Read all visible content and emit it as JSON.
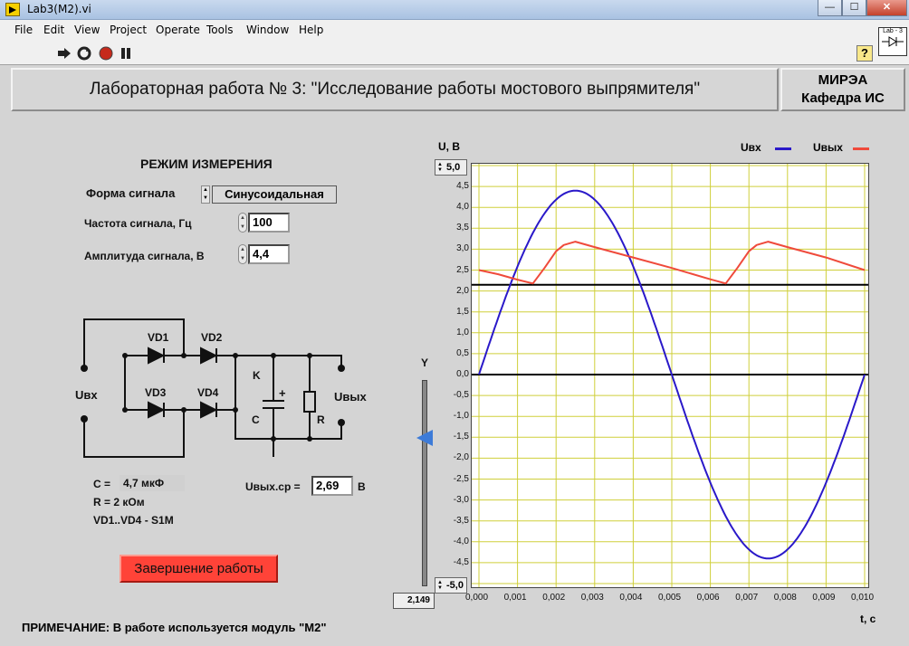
{
  "window": {
    "title": "Lab3(M2).vi",
    "minimize": "—",
    "maximize": "☐",
    "close": "✕"
  },
  "menu": [
    "File",
    "Edit",
    "View",
    "Project",
    "Operate",
    "Tools",
    "Window",
    "Help"
  ],
  "toolbar": {
    "help": "?",
    "lab_icon": "Lab - 3"
  },
  "header": {
    "title": "Лабораторная работа № 3: \"Исследование работы мостового выпрямителя\"",
    "org_line1": "МИРЭА",
    "org_line2": "Кафедра ИС"
  },
  "controls": {
    "mode_title": "РЕЖИМ ИЗМЕРЕНИЯ",
    "signal_form_label": "Форма сигнала",
    "signal_form_value": "Синусоидальная",
    "freq_label": "Частота сигнала, Гц",
    "freq_value": "100",
    "amp_label": "Амплитуда сигнала, В",
    "amp_value": "4,4"
  },
  "circuit": {
    "vd1": "VD1",
    "vd2": "VD2",
    "vd3": "VD3",
    "vd4": "VD4",
    "uin": "Uвх",
    "uout": "Uвых",
    "k": "K",
    "c": "C",
    "r": "R",
    "plus": "+"
  },
  "params": {
    "c_line_label": "C =",
    "c_line_value": "4,7 мкФ",
    "r_line": "R = 2 кОм",
    "diodes_line": "VD1..VD4 - S1M",
    "uavg_label": "Uвых.ср =",
    "uavg_value": "2,69",
    "uavg_unit": "В"
  },
  "finish_button": "Завершение работы",
  "note": "ПРИМЕЧАНИЕ: В работе используется модуль \"М2\"",
  "slider": {
    "label": "Y",
    "value": "2,149",
    "level": 2.149
  },
  "graph": {
    "ylabel": "U, В",
    "xlabel": "t, c",
    "ymax_box": "5,0",
    "ymin_box": "-5,0",
    "legend_in": "Uвх",
    "legend_out": "Uвых"
  },
  "colors": {
    "uin": "#2a19c9",
    "uout": "#ef4a3b",
    "grid": "#cfcf3a",
    "cursor": "#000000"
  },
  "chart_data": {
    "type": "line",
    "title": "",
    "xlabel": "t, c",
    "ylabel": "U, В",
    "xlim": [
      0,
      0.01
    ],
    "ylim": [
      -5,
      5
    ],
    "x_ticks": [
      "0,000",
      "0,001",
      "0,002",
      "0,003",
      "0,004",
      "0,005",
      "0,006",
      "0,007",
      "0,008",
      "0,009",
      "0,010"
    ],
    "y_ticks": [
      "4,5",
      "4,0",
      "3,5",
      "3,0",
      "2,5",
      "2,0",
      "1,5",
      "1,0",
      "0,5",
      "0,0",
      "-0,5",
      "-1,0",
      "-1,5",
      "-2,0",
      "-2,5",
      "-3,0",
      "-3,5",
      "-4,0",
      "-4,5"
    ],
    "grid": true,
    "legend_position": "top-right",
    "series": [
      {
        "name": "Uвх",
        "amplitude": 4.4,
        "frequency": 100,
        "x": [
          0,
          0.0005,
          0.001,
          0.0015,
          0.002,
          0.0025,
          0.003,
          0.0035,
          0.004,
          0.0045,
          0.005,
          0.0055,
          0.006,
          0.0065,
          0.007,
          0.0075,
          0.008,
          0.0085,
          0.009,
          0.0095,
          0.01
        ],
        "y": [
          0.0,
          1.36,
          2.59,
          3.56,
          4.18,
          4.4,
          4.18,
          3.56,
          2.59,
          1.36,
          0.0,
          -1.36,
          -2.59,
          -3.56,
          -4.18,
          -4.4,
          -4.18,
          -3.56,
          -2.59,
          -1.36,
          0.0
        ]
      },
      {
        "name": "Uвых",
        "x": [
          0,
          0.0005,
          0.001,
          0.0014,
          0.0017,
          0.002,
          0.0022,
          0.0025,
          0.003,
          0.004,
          0.005,
          0.006,
          0.0064,
          0.0067,
          0.007,
          0.0072,
          0.0075,
          0.008,
          0.009,
          0.01
        ],
        "y": [
          2.5,
          2.4,
          2.27,
          2.18,
          2.55,
          2.95,
          3.1,
          3.18,
          3.05,
          2.8,
          2.55,
          2.28,
          2.18,
          2.55,
          2.95,
          3.1,
          3.18,
          3.05,
          2.8,
          2.5
        ]
      }
    ],
    "cursors": [
      {
        "name": "Y",
        "y": 2.149
      },
      {
        "name": "zero",
        "y": 0.0
      }
    ]
  }
}
